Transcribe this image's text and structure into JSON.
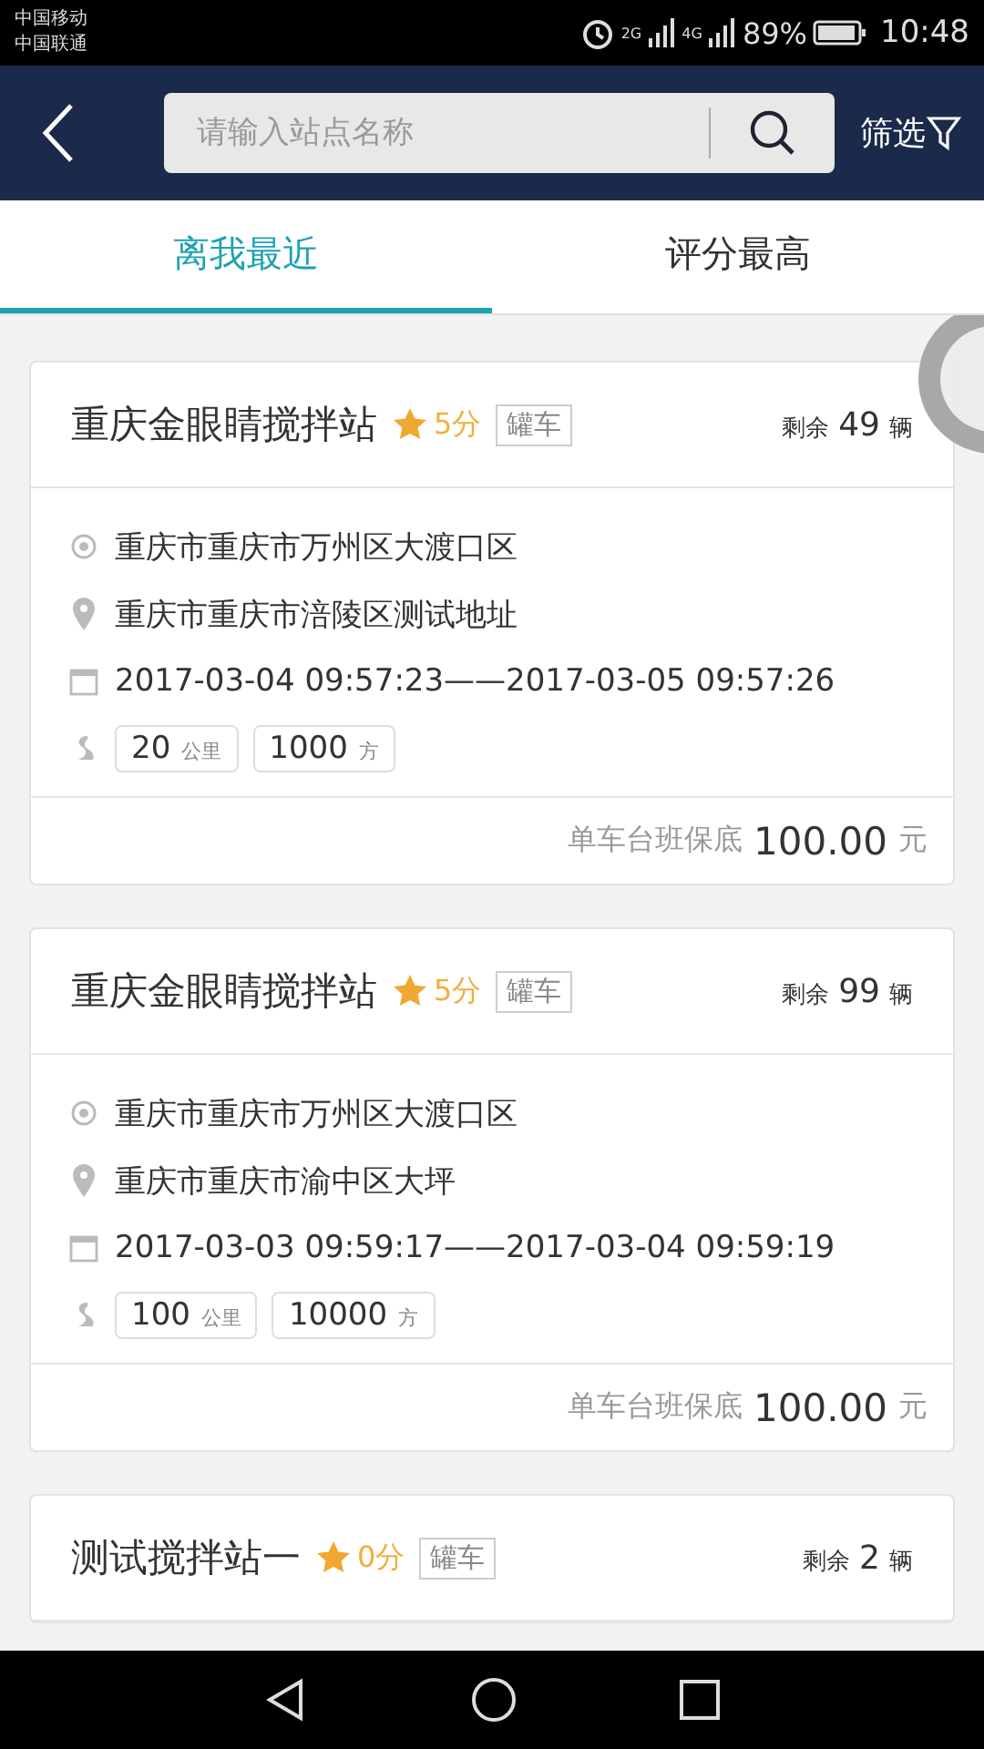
{
  "status_bar": {
    "carriers": [
      "中国移动",
      "中国联通"
    ],
    "network_1": "2G",
    "network_2": "4G",
    "battery": "89%",
    "time": "10:48"
  },
  "header": {
    "search_placeholder": "请输入站点名称",
    "filter_label": "筛选"
  },
  "tabs": [
    {
      "label": "离我最近",
      "selected": true
    },
    {
      "label": "评分最高",
      "selected": false
    }
  ],
  "stations": [
    {
      "name": "重庆金眼睛搅拌站",
      "score": "5分",
      "tag": "罐车",
      "remaining_label": "剩余",
      "remaining": "49",
      "remaining_unit": "辆",
      "from": "重庆市重庆市万州区大渡口区",
      "to": "重庆市重庆市涪陵区测试地址",
      "time_range": "2017-03-04 09:57:23——2017-03-05 09:57:26",
      "distance": "20",
      "distance_unit": "公里",
      "volume": "1000",
      "volume_unit": "方",
      "price_label": "单车台班保底",
      "price": "100.00",
      "price_unit": "元"
    },
    {
      "name": "重庆金眼睛搅拌站",
      "score": "5分",
      "tag": "罐车",
      "remaining_label": "剩余",
      "remaining": "99",
      "remaining_unit": "辆",
      "from": "重庆市重庆市万州区大渡口区",
      "to": "重庆市重庆市渝中区大坪",
      "time_range": "2017-03-03 09:59:17——2017-03-04 09:59:19",
      "distance": "100",
      "distance_unit": "公里",
      "volume": "10000",
      "volume_unit": "方",
      "price_label": "单车台班保底",
      "price": "100.00",
      "price_unit": "元"
    },
    {
      "name": "测试搅拌站一",
      "score": "0分",
      "tag": "罐车",
      "remaining_label": "剩余",
      "remaining": "2",
      "remaining_unit": "辆"
    }
  ]
}
